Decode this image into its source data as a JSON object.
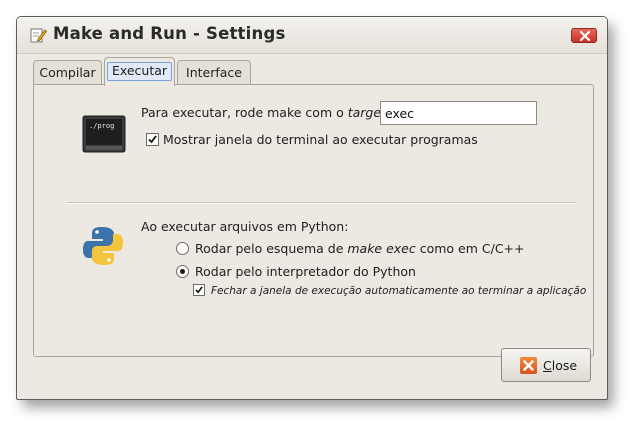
{
  "window": {
    "title": "Make and Run - Settings"
  },
  "tabs": [
    {
      "label": "Compilar"
    },
    {
      "label": "Executar"
    },
    {
      "label": "Interface"
    }
  ],
  "execute": {
    "target_label_prefix": "Para executar, rode make com o ",
    "target_label_italic": "target",
    "target_label_suffix": ":",
    "target_value": "exec",
    "terminal_icon_text": "./prog",
    "show_terminal_label": "Mostrar janela do terminal ao executar programas",
    "show_terminal_checked": true
  },
  "python": {
    "heading": "Ao executar arquivos em Python:",
    "option_make_prefix": "Rodar pelo esquema de ",
    "option_make_italic": "make exec",
    "option_make_suffix": " como em C/C++",
    "option_make_selected": false,
    "option_interp_label": "Rodar pelo interpretador do Python",
    "option_interp_selected": true,
    "auto_close_label": "Fechar a janela de execução automaticamente ao terminar a aplicação",
    "auto_close_checked": true
  },
  "footer": {
    "close_first_letter": "C",
    "close_rest": "lose"
  },
  "icons": {
    "app": "document-edit-icon",
    "window_close": "close-icon",
    "terminal": "terminal-icon",
    "python": "python-icon",
    "button_close": "close-icon"
  },
  "colors": {
    "accent_tab": "#dfe9f8",
    "close_red": "#c8322a",
    "close_orange": "#d8541b"
  }
}
